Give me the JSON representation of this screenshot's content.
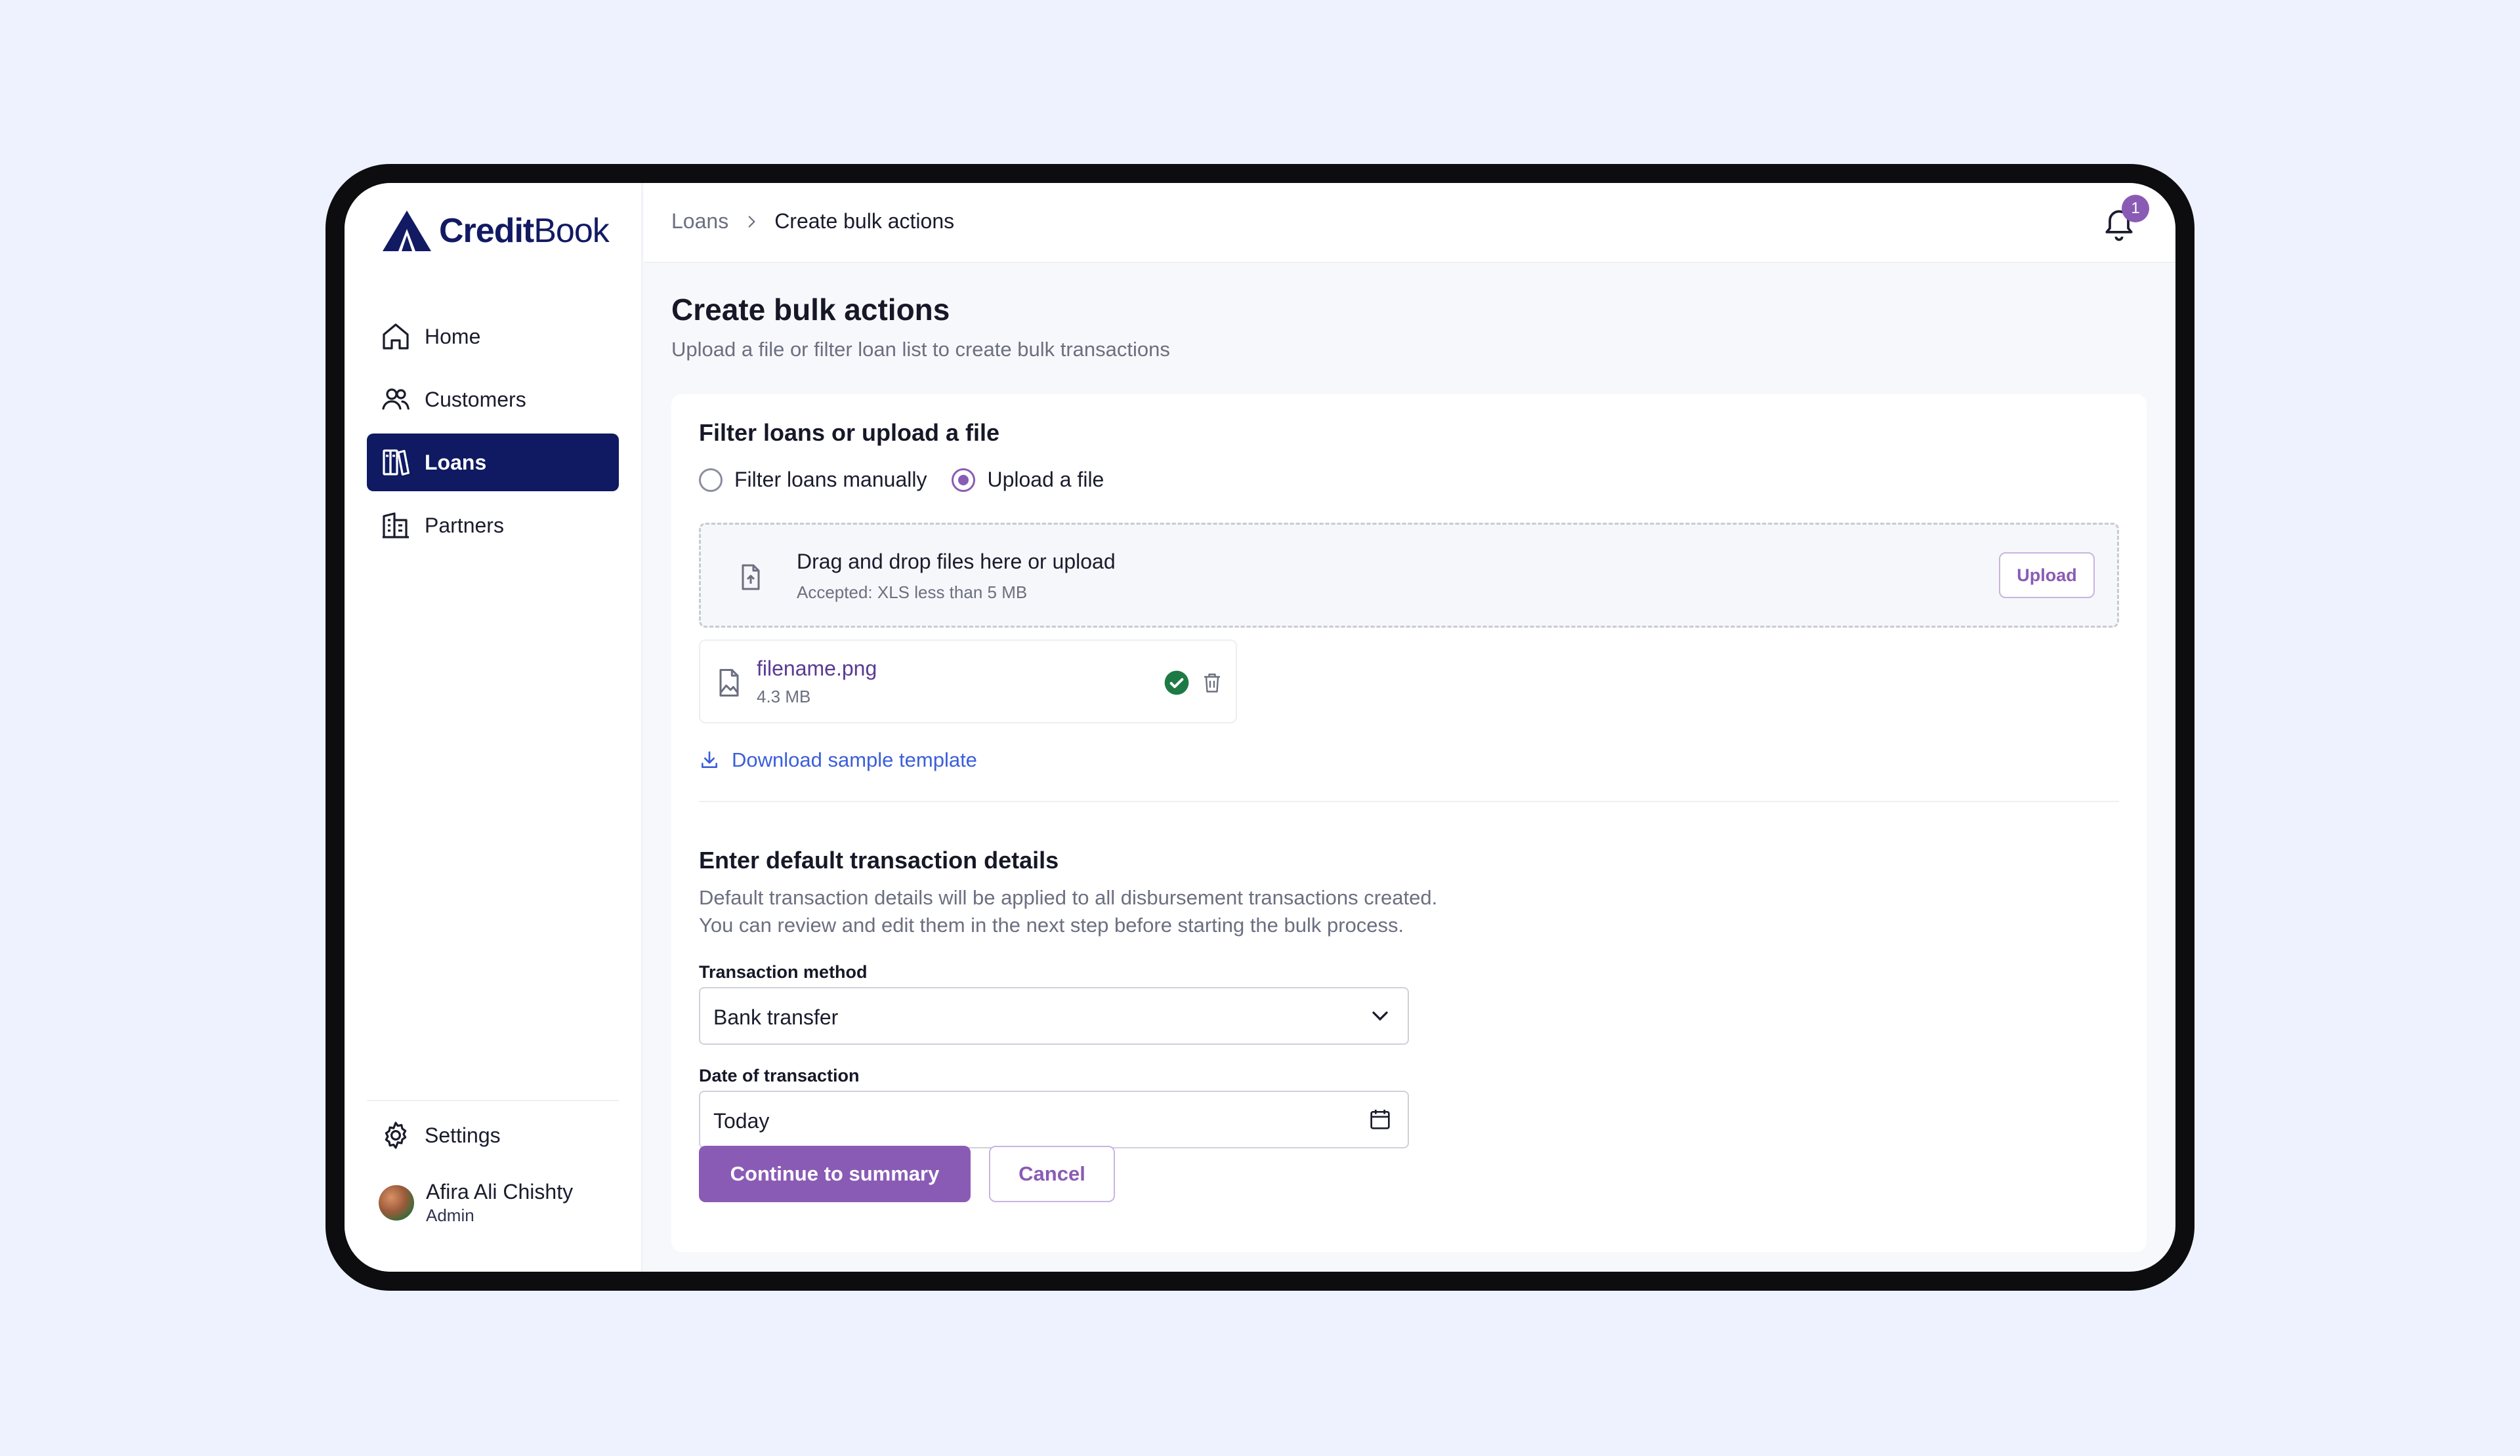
{
  "brand": {
    "name_bold": "Credit",
    "name_regular": "Book"
  },
  "sidebar": {
    "items": [
      {
        "label": "Home",
        "icon": "home-icon"
      },
      {
        "label": "Customers",
        "icon": "users-icon"
      },
      {
        "label": "Loans",
        "icon": "book-icon",
        "active": true
      },
      {
        "label": "Partners",
        "icon": "building-icon"
      }
    ],
    "settings_label": "Settings",
    "user": {
      "name": "Afira Ali Chishty",
      "role": "Admin"
    }
  },
  "topbar": {
    "breadcrumb": [
      "Loans",
      "Create bulk actions"
    ],
    "notification_count": "1"
  },
  "page": {
    "title": "Create bulk actions",
    "subtitle": "Upload a file or filter loan list to create bulk transactions"
  },
  "filter_section": {
    "title": "Filter loans or upload a file",
    "option_manual": "Filter loans manually",
    "option_upload": "Upload a file",
    "selected": "Upload a file"
  },
  "dropzone": {
    "main_text": "Drag and drop files here or upload",
    "accepted_text": "Accepted: XLS less than 5 MB",
    "upload_label": "Upload"
  },
  "uploaded_file": {
    "name": "filename.png",
    "size": "4.3 MB"
  },
  "download_template_label": "Download sample template",
  "details_section": {
    "title": "Enter default transaction details",
    "description_line1": "Default transaction details will be applied to all disbursement transactions created.",
    "description_line2": "You can review and edit them in the next step before starting the bulk process.",
    "method_label": "Transaction method",
    "method_value": "Bank transfer",
    "date_label": "Date of transaction",
    "date_value": "Today"
  },
  "actions": {
    "continue_label": "Continue to summary",
    "cancel_label": "Cancel"
  },
  "colors": {
    "accent": "#8a5bb5",
    "nav_active": "#0f1a62",
    "link": "#3b5fd9",
    "success": "#1e7a45",
    "background": "#eef2fe"
  }
}
